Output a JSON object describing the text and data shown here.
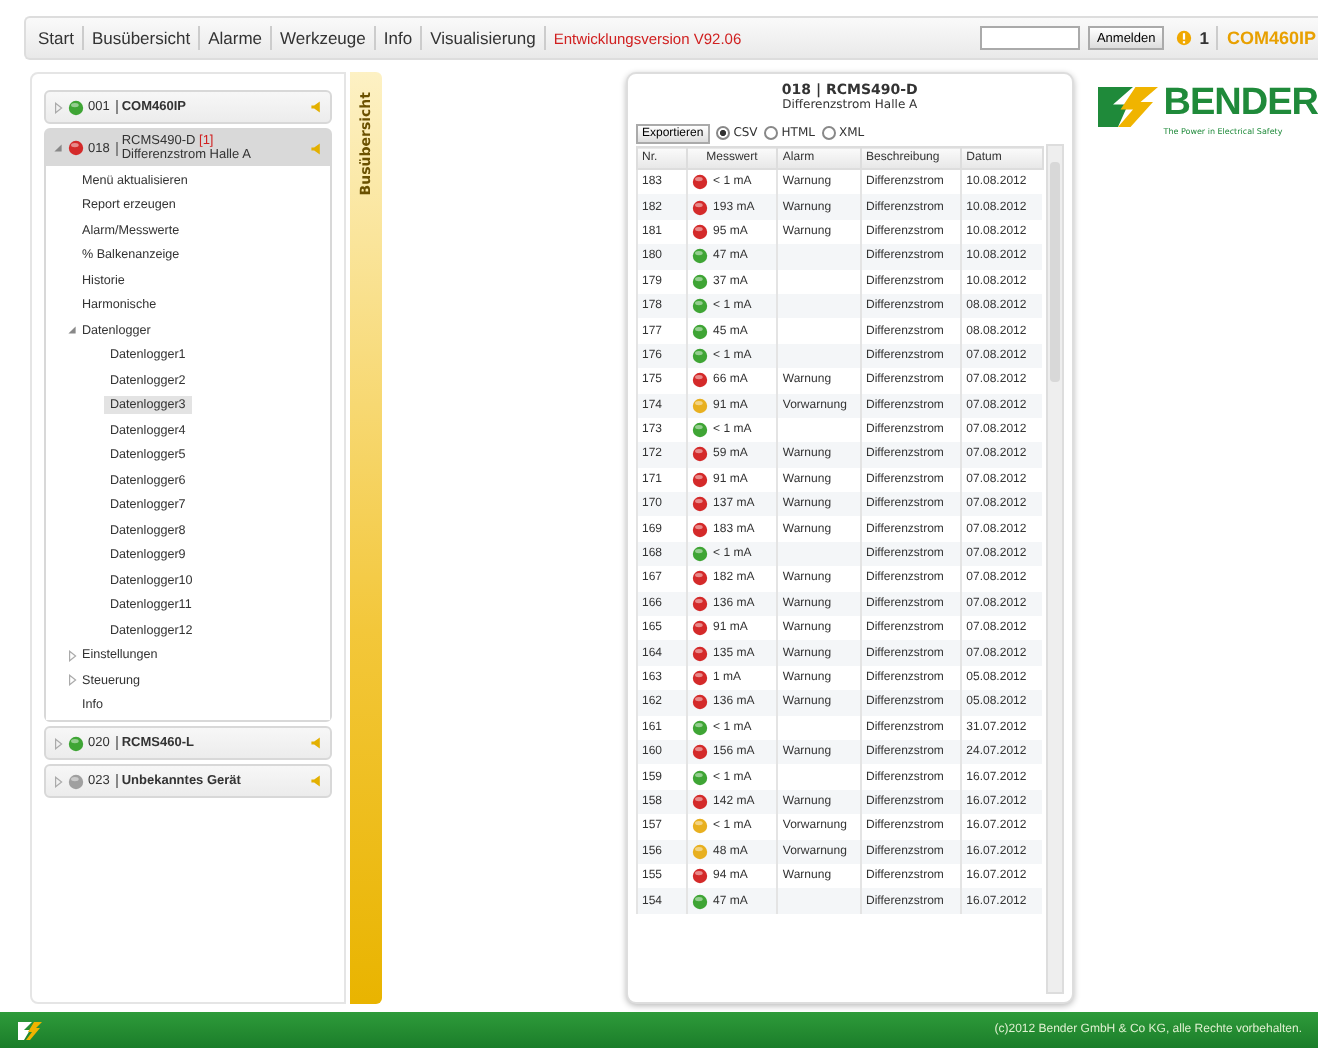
{
  "nav": {
    "items": [
      "Start",
      "Busübersicht",
      "Alarme",
      "Werkzeuge",
      "Info",
      "Visualisierung"
    ],
    "version": "Entwicklungsversion V92.06",
    "login_button": "Anmelden",
    "alarm_count": "1",
    "device": "COM460IP"
  },
  "sidebar": {
    "tab": "Busübersicht",
    "devices": [
      {
        "address": "001",
        "name": "COM460IP",
        "color": "#3fa535",
        "expanded": false
      },
      {
        "address": "018",
        "name": "RCMS490-D",
        "alarm": "[1]",
        "subtitle": "Differenzstrom Halle A",
        "color": "#d42a2a",
        "expanded": true,
        "children": [
          {
            "label": "Menü aktualisieren",
            "selected": false
          },
          {
            "label": "Report erzeugen",
            "selected": false
          },
          {
            "label": "Alarm/Messwerte",
            "selected": false
          },
          {
            "label": "% Balkenanzeige",
            "selected": false
          },
          {
            "label": "Historie",
            "selected": false
          },
          {
            "label": "Harmonische",
            "selected": false
          },
          {
            "label": "Datenlogger",
            "selected": false,
            "expanded": true,
            "children": [
              {
                "label": "Datenlogger1",
                "selected": false
              },
              {
                "label": "Datenlogger2",
                "selected": false
              },
              {
                "label": "Datenlogger3",
                "selected": true
              },
              {
                "label": "Datenlogger4",
                "selected": false
              },
              {
                "label": "Datenlogger5",
                "selected": false
              },
              {
                "label": "Datenlogger6",
                "selected": false
              },
              {
                "label": "Datenlogger7",
                "selected": false
              },
              {
                "label": "Datenlogger8",
                "selected": false
              },
              {
                "label": "Datenlogger9",
                "selected": false
              },
              {
                "label": "Datenlogger10",
                "selected": false
              },
              {
                "label": "Datenlogger11",
                "selected": false
              },
              {
                "label": "Datenlogger12",
                "selected": false
              }
            ]
          },
          {
            "label": "Einstellungen",
            "selected": false,
            "expanded": false
          },
          {
            "label": "Steuerung",
            "selected": false,
            "expanded": false
          },
          {
            "label": "Info",
            "selected": false
          }
        ]
      },
      {
        "address": "020",
        "name": "RCMS460-L",
        "color": "#3fa535",
        "expanded": false
      },
      {
        "address": "023",
        "name": "Unbekanntes Gerät",
        "color": "#a0a0a0",
        "expanded": false
      }
    ]
  },
  "logger": {
    "title": "018 | RCMS490-D",
    "subtitle": "Differenzstrom Halle A",
    "export_button": "Exportieren",
    "formats": [
      {
        "label": "CSV",
        "selected": true
      },
      {
        "label": "HTML",
        "selected": false
      },
      {
        "label": "XML",
        "selected": false
      }
    ],
    "columns": [
      "Nr.",
      "Messwert",
      "Alarm",
      "Beschreibung",
      "Datum"
    ],
    "rows": [
      {
        "nr": "183",
        "color": "#d42a2a",
        "value": "< 1 mA",
        "alarm": "Warnung",
        "description": "Differenzstrom",
        "date": "10.08.2012"
      },
      {
        "nr": "182",
        "color": "#d42a2a",
        "value": "193 mA",
        "alarm": "Warnung",
        "description": "Differenzstrom",
        "date": "10.08.2012"
      },
      {
        "nr": "181",
        "color": "#d42a2a",
        "value": "95 mA",
        "alarm": "Warnung",
        "description": "Differenzstrom",
        "date": "10.08.2012"
      },
      {
        "nr": "180",
        "color": "#3fa535",
        "value": "47 mA",
        "description": "Differenzstrom",
        "date": "10.08.2012"
      },
      {
        "nr": "179",
        "color": "#3fa535",
        "value": "37 mA",
        "description": "Differenzstrom",
        "date": "10.08.2012"
      },
      {
        "nr": "178",
        "color": "#3fa535",
        "value": "< 1 mA",
        "description": "Differenzstrom",
        "date": "08.08.2012"
      },
      {
        "nr": "177",
        "color": "#3fa535",
        "value": "45 mA",
        "description": "Differenzstrom",
        "date": "08.08.2012"
      },
      {
        "nr": "176",
        "color": "#3fa535",
        "value": "< 1 mA",
        "description": "Differenzstrom",
        "date": "07.08.2012"
      },
      {
        "nr": "175",
        "color": "#d42a2a",
        "value": "66 mA",
        "alarm": "Warnung",
        "description": "Differenzstrom",
        "date": "07.08.2012"
      },
      {
        "nr": "174",
        "color": "#e8b020",
        "value": "91 mA",
        "alarm": "Vorwarnung",
        "description": "Differenzstrom",
        "date": "07.08.2012"
      },
      {
        "nr": "173",
        "color": "#3fa535",
        "value": "< 1 mA",
        "description": "Differenzstrom",
        "date": "07.08.2012"
      },
      {
        "nr": "172",
        "color": "#d42a2a",
        "value": "59 mA",
        "alarm": "Warnung",
        "description": "Differenzstrom",
        "date": "07.08.2012"
      },
      {
        "nr": "171",
        "color": "#d42a2a",
        "value": "91 mA",
        "alarm": "Warnung",
        "description": "Differenzstrom",
        "date": "07.08.2012"
      },
      {
        "nr": "170",
        "color": "#d42a2a",
        "value": "137 mA",
        "alarm": "Warnung",
        "description": "Differenzstrom",
        "date": "07.08.2012"
      },
      {
        "nr": "169",
        "color": "#d42a2a",
        "value": "183 mA",
        "alarm": "Warnung",
        "description": "Differenzstrom",
        "date": "07.08.2012"
      },
      {
        "nr": "168",
        "color": "#3fa535",
        "value": "< 1 mA",
        "description": "Differenzstrom",
        "date": "07.08.2012"
      },
      {
        "nr": "167",
        "color": "#d42a2a",
        "value": "182 mA",
        "alarm": "Warnung",
        "description": "Differenzstrom",
        "date": "07.08.2012"
      },
      {
        "nr": "166",
        "color": "#d42a2a",
        "value": "136 mA",
        "alarm": "Warnung",
        "description": "Differenzstrom",
        "date": "07.08.2012"
      },
      {
        "nr": "165",
        "color": "#d42a2a",
        "value": "91 mA",
        "alarm": "Warnung",
        "description": "Differenzstrom",
        "date": "07.08.2012"
      },
      {
        "nr": "164",
        "color": "#d42a2a",
        "value": "135 mA",
        "alarm": "Warnung",
        "description": "Differenzstrom",
        "date": "07.08.2012"
      },
      {
        "nr": "163",
        "color": "#d42a2a",
        "value": "1 mA",
        "alarm": "Warnung",
        "description": "Differenzstrom",
        "date": "05.08.2012"
      },
      {
        "nr": "162",
        "color": "#d42a2a",
        "value": "136 mA",
        "alarm": "Warnung",
        "description": "Differenzstrom",
        "date": "05.08.2012"
      },
      {
        "nr": "161",
        "color": "#3fa535",
        "value": "< 1 mA",
        "description": "Differenzstrom",
        "date": "31.07.2012"
      },
      {
        "nr": "160",
        "color": "#d42a2a",
        "value": "156 mA",
        "alarm": "Warnung",
        "description": "Differenzstrom",
        "date": "24.07.2012"
      },
      {
        "nr": "159",
        "color": "#3fa535",
        "value": "< 1 mA",
        "description": "Differenzstrom",
        "date": "16.07.2012"
      },
      {
        "nr": "158",
        "color": "#d42a2a",
        "value": "142 mA",
        "alarm": "Warnung",
        "description": "Differenzstrom",
        "date": "16.07.2012"
      },
      {
        "nr": "157",
        "color": "#e8b020",
        "value": "< 1 mA",
        "alarm": "Vorwarnung",
        "description": "Differenzstrom",
        "date": "16.07.2012"
      },
      {
        "nr": "156",
        "color": "#e8b020",
        "value": "48 mA",
        "alarm": "Vorwarnung",
        "description": "Differenzstrom",
        "date": "16.07.2012"
      },
      {
        "nr": "155",
        "color": "#d42a2a",
        "value": "94 mA",
        "alarm": "Warnung",
        "description": "Differenzstrom",
        "date": "16.07.2012"
      },
      {
        "nr": "154",
        "color": "#3fa535",
        "value": "47 mA",
        "description": "Differenzstrom",
        "date": "16.07.2012"
      }
    ]
  },
  "logo": {
    "name": "BENDER",
    "tagline": "The Power in Electrical Safety"
  },
  "footer": "(c)2012 Bender GmbH & Co KG, alle Rechte vorbehalten."
}
